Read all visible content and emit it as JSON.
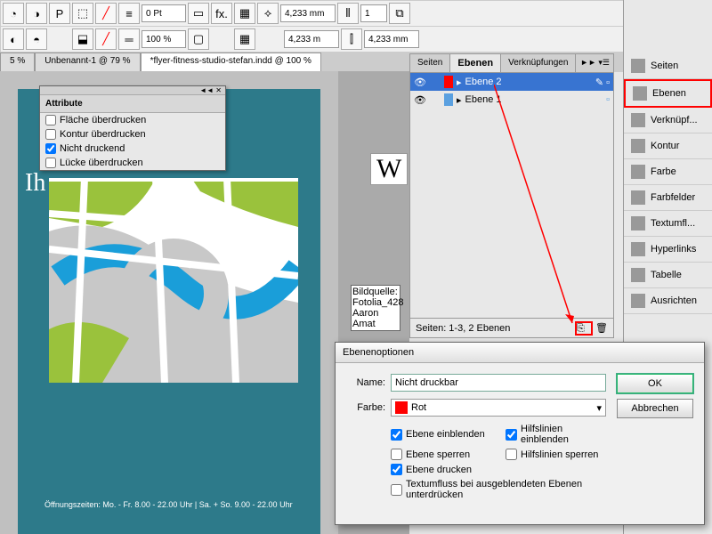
{
  "toolbar": {
    "pt": "0 Pt",
    "zoom": "100 %",
    "w": "4,233 mm",
    "h": "4,233 m",
    "one": "1"
  },
  "tabs": {
    "t1": "5 %",
    "t2": "Unbenannt-1 @ 79 %",
    "t3": "*flyer-fitness-studio-stefan.indd @ 100 %"
  },
  "attr": {
    "title": "Attribute",
    "c1": "Fläche überdrucken",
    "c2": "Kontur überdrucken",
    "c3": "Nicht druckend",
    "c4": "Lücke überdrucken"
  },
  "layers": {
    "tab1": "Seiten",
    "tab2": "Ebenen",
    "tab3": "Verknüpfungen",
    "l1": "Ebene 2",
    "l2": "Ebene 1",
    "foot": "Seiten: 1-3, 2 Ebenen"
  },
  "right": {
    "seiten": "Seiten",
    "ebenen": "Ebenen",
    "verkn": "Verknüpf...",
    "kontur": "Kontur",
    "farbe": "Farbe",
    "farbf": "Farbfelder",
    "textum": "Textumfl...",
    "hyper": "Hyperlinks",
    "tabelle": "Tabelle",
    "ausr": "Ausrichten"
  },
  "dlg": {
    "title": "Ebenenoptionen",
    "name_lbl": "Name:",
    "name_val": "Nicht druckbar",
    "farbe_lbl": "Farbe:",
    "farbe_val": "Rot",
    "c1": "Ebene einblenden",
    "c2": "Hilfslinien einblenden",
    "c3": "Ebene sperren",
    "c4": "Hilfslinien sperren",
    "c5": "Ebene drucken",
    "c6": "Textumfluss bei ausgeblendeten Ebenen unterdrücken",
    "ok": "OK",
    "cancel": "Abbrechen"
  },
  "page": {
    "ih": "Ih",
    "w": "W",
    "hours": "Öffnungszeiten: Mo. - Fr. 8.00 - 22.00 Uhr | Sa. + So. 9.00 - 22.00 Uhr"
  },
  "credit": {
    "a": "Bildquelle:",
    "b": "Fotolia_428",
    "c": "Aaron Amat"
  }
}
